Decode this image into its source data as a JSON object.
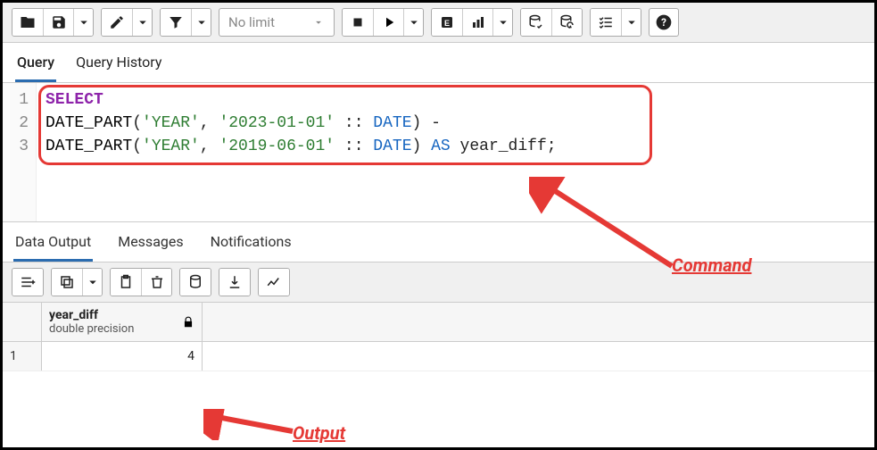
{
  "toolbar": {
    "limit_label": "No limit"
  },
  "tabs": {
    "query": "Query",
    "history": "Query History"
  },
  "editor": {
    "lines": [
      "1",
      "2",
      "3"
    ],
    "sql": {
      "select": "SELECT",
      "fn": "DATE_PART",
      "yr": "'YEAR'",
      "d1": "'2023-01-01'",
      "d2": "'2019-06-01'",
      "cast": ":: ",
      "date_kw": "DATE",
      "minus": " -",
      "as": "AS",
      "alias": " year_diff;"
    }
  },
  "out_tabs": {
    "data": "Data Output",
    "messages": "Messages",
    "notifications": "Notifications"
  },
  "result": {
    "col_name": "year_diff",
    "col_type": "double precision",
    "row_num": "1",
    "value": "4"
  },
  "annotations": {
    "command": "Command",
    "output": "Output"
  }
}
